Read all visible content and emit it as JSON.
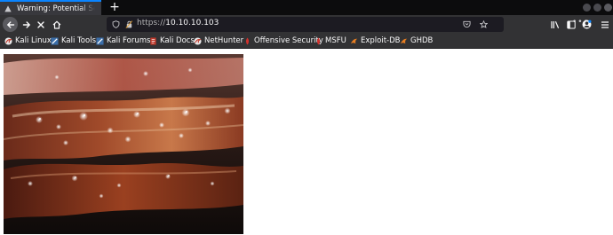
{
  "tabs": [
    {
      "title": "Warning: Potential Security Risk Ahead",
      "active": true
    }
  ],
  "new_tab_label": "+",
  "navigation": {
    "back_icon": "back-arrow-icon",
    "forward_icon": "forward-arrow-icon",
    "stop_icon": "stop-icon",
    "home_icon": "home-icon"
  },
  "urlbar": {
    "protocol": "https://",
    "host": "10.10.10.103",
    "menu_glyph": "•••"
  },
  "toolbar_icons": [
    "library-icon",
    "sidebar-icon",
    "account-icon",
    "menu-icon"
  ],
  "bookmarks": [
    {
      "label": "Kali Linux",
      "icon": "kali-icon"
    },
    {
      "label": "Kali Tools",
      "icon": "kali-tools-icon"
    },
    {
      "label": "Kali Forums",
      "icon": "kali-forums-icon"
    },
    {
      "label": "Kali Docs",
      "icon": "kali-docs-icon"
    },
    {
      "label": "NetHunter",
      "icon": "nethunter-icon"
    },
    {
      "label": "Offensive Security",
      "icon": "offsec-icon"
    },
    {
      "label": "MSFU",
      "icon": "msfu-icon"
    },
    {
      "label": "Exploit-DB",
      "icon": "exploitdb-icon"
    },
    {
      "label": "GHDB",
      "icon": "ghdb-icon"
    }
  ],
  "content": {
    "image_subject": "sizzling bacon strips"
  },
  "colors": {
    "tab_accent": "#0a84ff",
    "chrome_dark": "#0c0c0d",
    "toolbar": "#323234",
    "urlbar": "#1c1b22"
  }
}
